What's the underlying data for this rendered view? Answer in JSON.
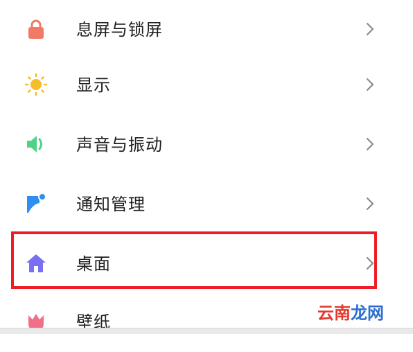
{
  "settings": {
    "items": [
      {
        "label": "息屏与锁屏",
        "icon": "lock-icon",
        "color": "#f07a66"
      },
      {
        "label": "显示",
        "icon": "sun-icon",
        "color": "#f6bd2a"
      },
      {
        "label": "声音与振动",
        "icon": "speaker-icon",
        "color": "#4fd18a"
      },
      {
        "label": "通知管理",
        "icon": "notification-flag-icon",
        "color": "#2f8ff0"
      },
      {
        "label": "桌面",
        "icon": "home-icon",
        "color": "#7a6ff0"
      },
      {
        "label": "壁纸",
        "icon": "tulip-icon",
        "color": "#f0708a"
      }
    ],
    "highlighted_item": "桌面",
    "highlight_color": "#ee1c25"
  },
  "watermark": {
    "text_part1": "云南",
    "text_part2": "龙网"
  }
}
